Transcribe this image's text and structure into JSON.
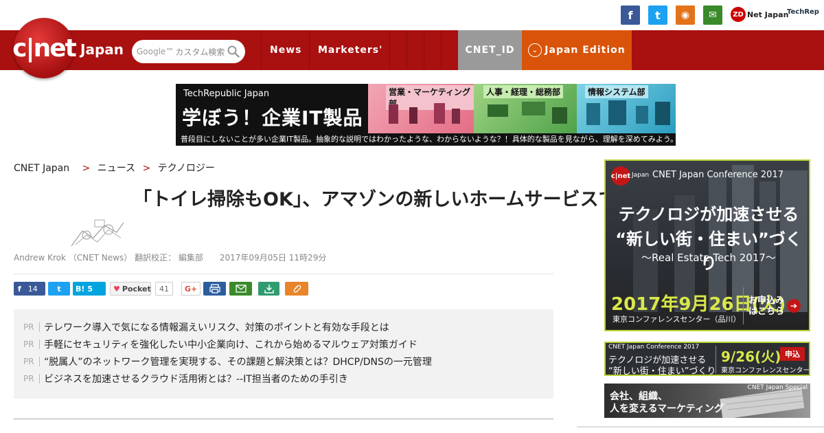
{
  "top": {
    "social": [
      {
        "name": "facebook",
        "glyph": "f",
        "color": "#3b5998"
      },
      {
        "name": "twitter",
        "glyph": "t",
        "color": "#1da1f2"
      },
      {
        "name": "rss",
        "glyph": "◉",
        "color": "#e2731b"
      },
      {
        "name": "mail",
        "glyph": "✉",
        "color": "#3a8a2b"
      }
    ],
    "zdnet": {
      "badge": "ZD",
      "label": "Net Japan"
    },
    "techrepublic": "TechRep"
  },
  "nav": {
    "logo_text": "c|net",
    "logo_japan": "Japan",
    "search_google": "Google™",
    "search_placeholder": "カスタム検索",
    "items": [
      "News",
      "Marketers'"
    ],
    "id_label": "CNET_ID",
    "edition_label": "Japan Edition",
    "edition_icon": "⌄"
  },
  "banner": {
    "brand": "TechRepublic Japan",
    "headline": "学ぼう！企業IT製品",
    "segments": [
      "営業・マーケティング部",
      "人事・経理・総務部",
      "情報システム部"
    ],
    "tagline": "普段目にしないことが多い企業IT製品。抽象的な説明ではわかったような、わからないような？！具体的な製品を見ながら、理解を深めてみよう。"
  },
  "breadcrumb": {
    "home": "CNET Japan",
    "sep": ">",
    "level1": "ニュース",
    "level2": "テクノロジー"
  },
  "article": {
    "title": "「トイレ掃除もOK」、アマゾンの新しいホームサービスでの仕事が人気に",
    "byline": "Andrew Krok （CNET News） 翻訳校正： 編集部　　2017年09月05日 11時29分"
  },
  "share": {
    "facebook_count": "14",
    "hatena_label": "B!",
    "hatena_count": "5",
    "pocket_label": "Pocket",
    "pocket_count": "41",
    "gplus_label": "G+"
  },
  "pr": {
    "tag": "PR",
    "items": [
      "テレワーク導入で気になる情報漏えいリスク、対策のポイントと有効な手段とは",
      "手軽にセキュリティを強化したい中小企業向け、これから始めるマルウェア対策ガイド",
      "“脱属人”のネットワーク管理を実現する、その課題と解決策とは？DHCP/DNSの一元管理",
      "ビジネスを加速させるクラウド活用術とは？--IT担当者のための手引き"
    ]
  },
  "sidebar": {
    "ad1": {
      "logo": "c|net",
      "logo_small": "Japan",
      "conf": "CNET Japan Conference 2017",
      "line1": "テクノロジが加速させる",
      "line2": "“新しい街・住まい”づくり",
      "sub": "〜Real Estate Tech 2017〜",
      "date": "2017年9月26日(火)",
      "venue": "東京コンファレンスセンター（品川）",
      "apply1": "お申込み",
      "apply2": "はこちら",
      "arrow": "➔"
    },
    "ad2": {
      "top": "CNET Japan Conference 2017",
      "l1": "テクノロジが加速させる",
      "l2": "“新しい街・住まい”づくり",
      "date": "9/26(火)",
      "venue": "東京コンファレンスセンター",
      "apply": "申込"
    },
    "ad3": {
      "l1": "会社、組織、",
      "l2": "人を変えるマーケティング",
      "tag": "CNET Japan Special"
    }
  },
  "colors": {
    "nav_red": "#a91010",
    "edition_orange": "#d9540a",
    "id_gray": "#9a9a9a",
    "ad_accent": "#b8d335"
  }
}
